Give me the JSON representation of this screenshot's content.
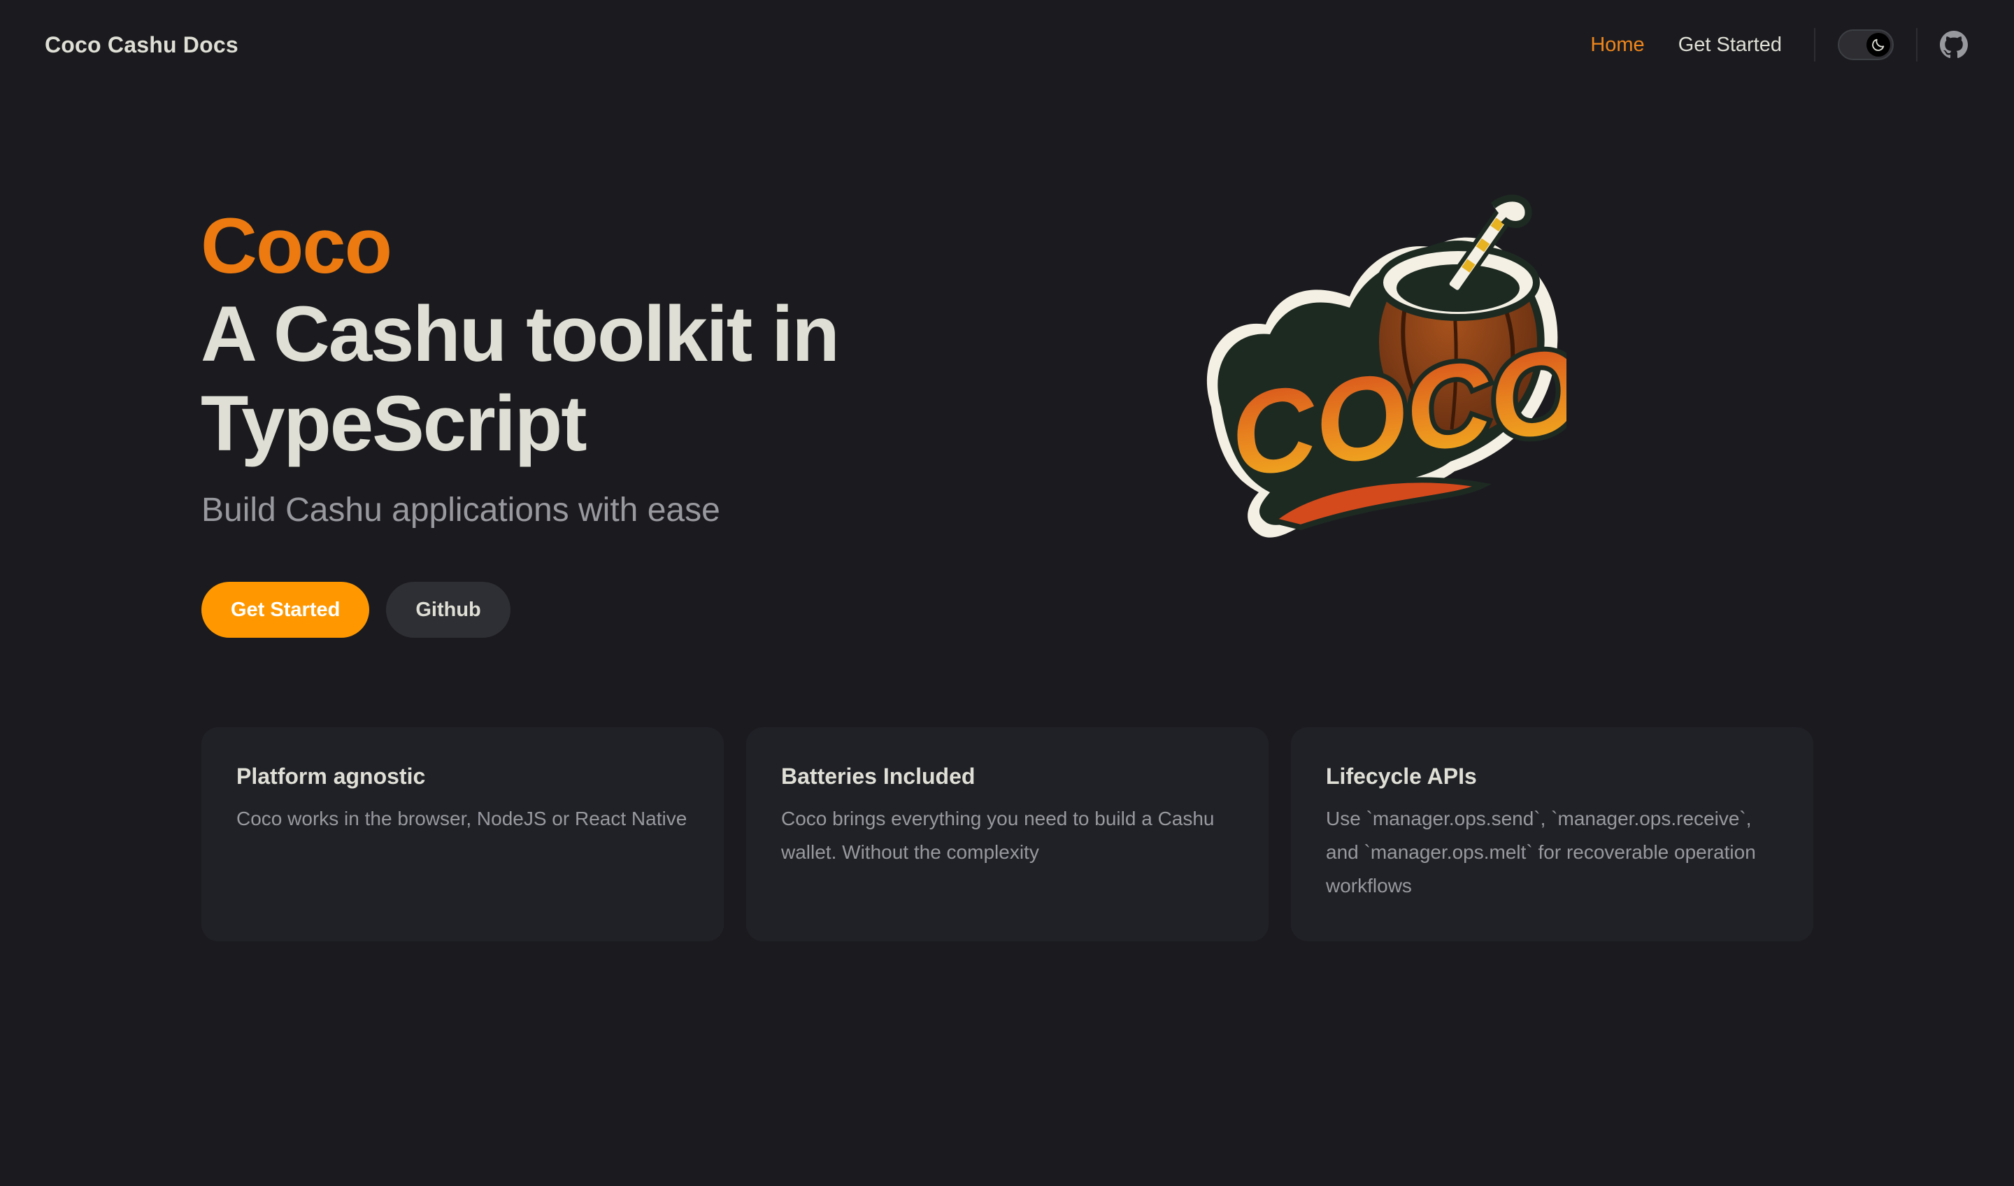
{
  "nav": {
    "brand": "Coco Cashu Docs",
    "links": [
      {
        "label": "Home",
        "active": true
      },
      {
        "label": "Get Started",
        "active": false
      }
    ],
    "theme_toggle_icon": "moon-icon",
    "github_icon": "github-icon"
  },
  "hero": {
    "name": "Coco",
    "text": "A Cashu toolkit in TypeScript",
    "tagline": "Build Cashu applications with ease",
    "actions": [
      {
        "label": "Get Started",
        "style": "primary"
      },
      {
        "label": "Github",
        "style": "secondary"
      }
    ],
    "logo_text": "COCO"
  },
  "features": [
    {
      "title": "Platform agnostic",
      "details": "Coco works in the browser, NodeJS or React Native"
    },
    {
      "title": "Batteries Included",
      "details": "Coco brings everything you need to build a Cashu wallet. Without the complexity"
    },
    {
      "title": "Lifecycle APIs",
      "details": "Use `manager.ops.send`, `manager.ops.receive`, and `manager.ops.melt` for recoverable operation workflows"
    }
  ],
  "colors": {
    "background": "#1b1b1f",
    "brand_orange": "#ec7a10",
    "button_primary": "#ff9800",
    "card_background": "#202127",
    "text_primary": "#dfdfd6",
    "text_muted": "#98989f"
  }
}
